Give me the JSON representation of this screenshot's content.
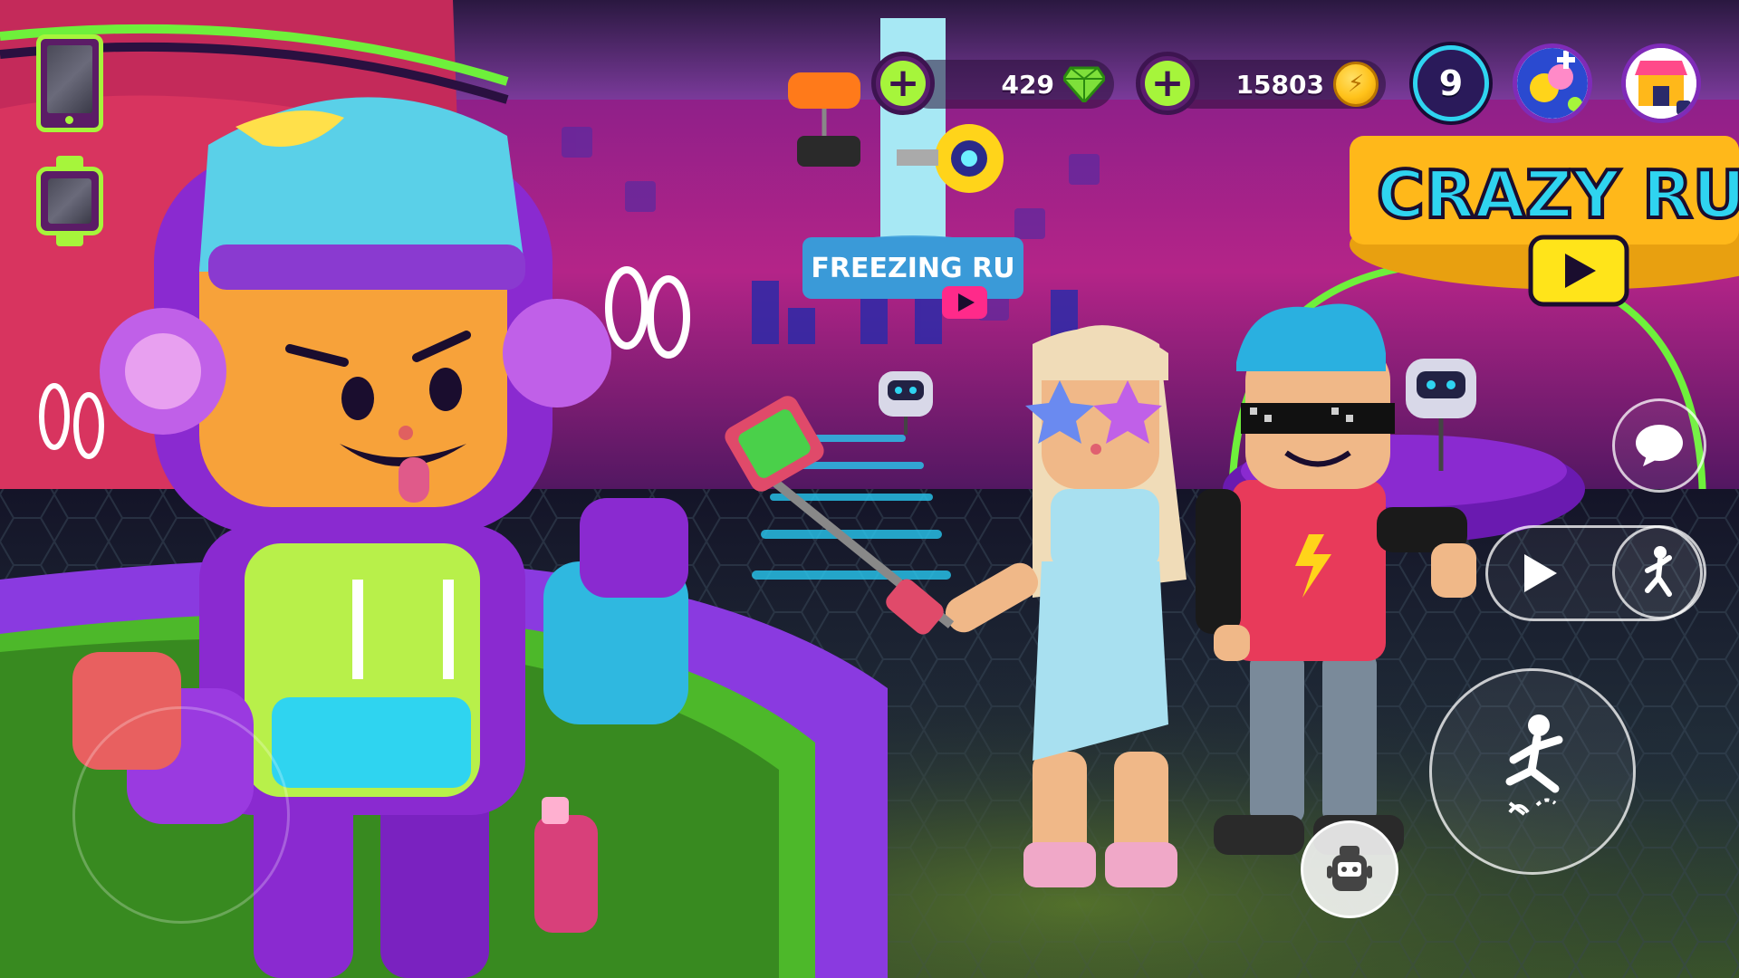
{
  "hud": {
    "gems": {
      "value": "429",
      "icon": "gem-icon",
      "color": "#7ee03a"
    },
    "coins": {
      "value": "15803",
      "icon": "coin-icon",
      "color": "#ffc21a"
    },
    "level": {
      "value": "9"
    },
    "accent_green": "#a6f53b",
    "accent_purple": "#5a1f6e"
  },
  "signs": {
    "freezing": "FREEZING RU",
    "crazy": "CRAZY RU"
  },
  "controls": {
    "chat": "chat-icon",
    "emote": "play-icon",
    "dance": "dance-icon",
    "jump": "jump-icon",
    "avatar": "avatar-icon"
  }
}
